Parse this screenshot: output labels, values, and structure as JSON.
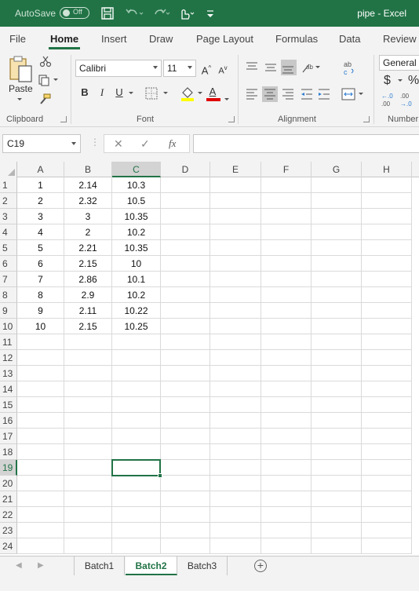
{
  "titlebar": {
    "autosave_label": "AutoSave",
    "autosave_state": "Off",
    "document_title": "pipe  -  Excel",
    "accent_color": "#217346"
  },
  "ribbon_tabs": [
    "File",
    "Home",
    "Insert",
    "Draw",
    "Page Layout",
    "Formulas",
    "Data",
    "Review"
  ],
  "active_ribbon_tab": "Home",
  "ribbon": {
    "clipboard": {
      "label": "Clipboard",
      "paste_label": "Paste"
    },
    "font": {
      "label": "Font",
      "font_name": "Calibri",
      "font_size": "11",
      "bold": "B",
      "italic": "I",
      "underline": "U",
      "grow": "A",
      "shrink": "A",
      "font_color_letter": "A"
    },
    "alignment": {
      "label": "Alignment"
    },
    "number": {
      "label": "Number",
      "format": "General",
      "currency": "$",
      "percent": "%",
      "dec_increase": "←.0 .00",
      "dec_decrease": ".00 →.0"
    }
  },
  "formula_bar": {
    "name_box": "C19",
    "fx_label": "fx",
    "value": ""
  },
  "grid": {
    "columns": [
      "A",
      "B",
      "C",
      "D",
      "E",
      "F",
      "G",
      "H"
    ],
    "selected_column": "C",
    "selected_row": 19,
    "row_count": 24,
    "rows": [
      [
        "1",
        "2.14",
        "10.3"
      ],
      [
        "2",
        "2.32",
        "10.5"
      ],
      [
        "3",
        "3",
        "10.35"
      ],
      [
        "4",
        "2",
        "10.2"
      ],
      [
        "5",
        "2.21",
        "10.35"
      ],
      [
        "6",
        "2.15",
        "10"
      ],
      [
        "7",
        "2.86",
        "10.1"
      ],
      [
        "8",
        "2.9",
        "10.2"
      ],
      [
        "9",
        "2.11",
        "10.22"
      ],
      [
        "10",
        "2.15",
        "10.25"
      ]
    ]
  },
  "sheets": {
    "tabs": [
      "Batch1",
      "Batch2",
      "Batch3"
    ],
    "active": "Batch2",
    "add_label": "+"
  }
}
